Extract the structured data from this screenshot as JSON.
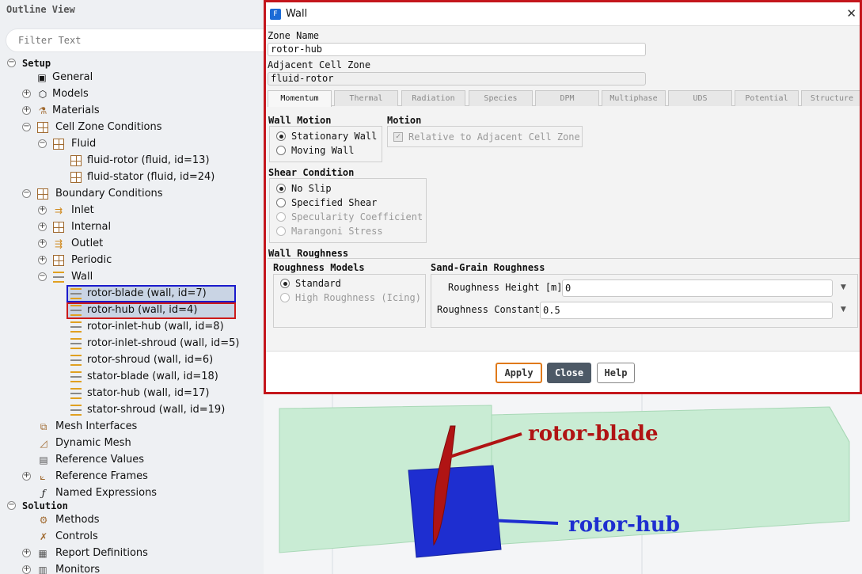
{
  "outline": {
    "title": "Outline View",
    "filter_placeholder": "Filter Text",
    "items": {
      "setup": "Setup",
      "general": "General",
      "models": "Models",
      "materials": "Materials",
      "cell_zone_conditions": "Cell Zone Conditions",
      "fluid": "Fluid",
      "fluid_rotor": "fluid-rotor (fluid, id=13)",
      "fluid_stator": "fluid-stator (fluid, id=24)",
      "boundary_conditions": "Boundary Conditions",
      "inlet": "Inlet",
      "internal": "Internal",
      "outlet": "Outlet",
      "periodic": "Periodic",
      "wall": "Wall",
      "rotor_blade": "rotor-blade (wall, id=7)",
      "rotor_hub": "rotor-hub (wall, id=4)",
      "rotor_inlet_hub": "rotor-inlet-hub (wall, id=8)",
      "rotor_inlet_shroud": "rotor-inlet-shroud (wall, id=5)",
      "rotor_shroud": "rotor-shroud (wall, id=6)",
      "stator_blade": "stator-blade (wall, id=18)",
      "stator_hub": "stator-hub (wall, id=17)",
      "stator_shroud": "stator-shroud (wall, id=19)",
      "mesh_interfaces": "Mesh Interfaces",
      "dynamic_mesh": "Dynamic Mesh",
      "reference_values": "Reference Values",
      "reference_frames": "Reference Frames",
      "named_expressions": "Named Expressions",
      "solution": "Solution",
      "methods": "Methods",
      "controls": "Controls",
      "report_definitions": "Report Definitions",
      "monitors": "Monitors"
    }
  },
  "dialog": {
    "title": "Wall",
    "app_icon": "F",
    "close_glyph": "✕",
    "zone_name_label": "Zone Name",
    "zone_name_value": "rotor-hub",
    "adjacent_label": "Adjacent Cell Zone",
    "adjacent_value": "fluid-rotor",
    "tabs": [
      "Momentum",
      "Thermal",
      "Radiation",
      "Species",
      "DPM",
      "Multiphase",
      "UDS",
      "Potential",
      "Structure"
    ],
    "active_tab": "Momentum",
    "wall_motion": {
      "title": "Wall Motion",
      "options": [
        "Stationary Wall",
        "Moving Wall"
      ],
      "selected": "Stationary Wall"
    },
    "motion": {
      "title": "Motion",
      "checkbox_label": "Relative to Adjacent Cell Zone",
      "checked": true,
      "enabled": false
    },
    "shear": {
      "title": "Shear Condition",
      "options": [
        "No Slip",
        "Specified Shear",
        "Specularity Coefficient",
        "Marangoni Stress"
      ],
      "selected": "No Slip"
    },
    "wall_roughness": {
      "title": "Wall Roughness",
      "models_title": "Roughness Models",
      "models": [
        "Standard",
        "High Roughness (Icing)"
      ],
      "selected": "Standard",
      "sand_grain_title": "Sand-Grain Roughness",
      "height_label": "Roughness Height [m]",
      "height_value": "0",
      "constant_label": "Roughness Constant",
      "constant_value": "0.5"
    },
    "buttons": {
      "apply": "Apply",
      "close": "Close",
      "help": "Help"
    }
  },
  "view3d": {
    "rotor_blade_label": "rotor-blade",
    "rotor_hub_label": "rotor-hub",
    "colors": {
      "blade": "#b01414",
      "hub": "#1e2ed0",
      "domain": "#c9ecd4",
      "highlight_blue": "#1a1acc",
      "highlight_red": "#cc1a1a"
    }
  }
}
